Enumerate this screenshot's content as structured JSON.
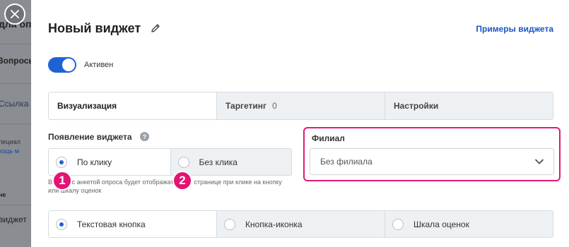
{
  "background": {
    "texts": [
      "дла опр",
      "Вопросы",
      "Ссылка",
      "специал",
      "омощь м",
      "не",
      "виджет"
    ]
  },
  "modal": {
    "title": "Новый виджет",
    "examples_link": "Примеры виджета",
    "active_toggle": {
      "label": "Активен",
      "on": true
    },
    "tabs": [
      {
        "label": "Визуализация",
        "count": ""
      },
      {
        "label": "Таргетинг",
        "count": "0"
      },
      {
        "label": "Настройки",
        "count": ""
      }
    ],
    "appearance": {
      "label": "Появление виджета",
      "help": "?",
      "options": [
        {
          "label": "По клику",
          "selected": true
        },
        {
          "label": "Без клика",
          "selected": false
        }
      ],
      "hint": "Виджет с анкетой опроса будет отображаться на странице при клике на кнопку или шкалу оценок"
    },
    "branch": {
      "label": "Филиал",
      "value": "Без филиала"
    },
    "button_type": {
      "options": [
        {
          "label": "Текстовая кнопка",
          "selected": true
        },
        {
          "label": "Кнопка-иконка",
          "selected": false
        },
        {
          "label": "Шкала оценок",
          "selected": false
        }
      ]
    }
  },
  "annotations": {
    "badge1": "1",
    "badge2": "2"
  },
  "colors": {
    "accent": "#1e63d6",
    "highlight": "#e0197a"
  }
}
